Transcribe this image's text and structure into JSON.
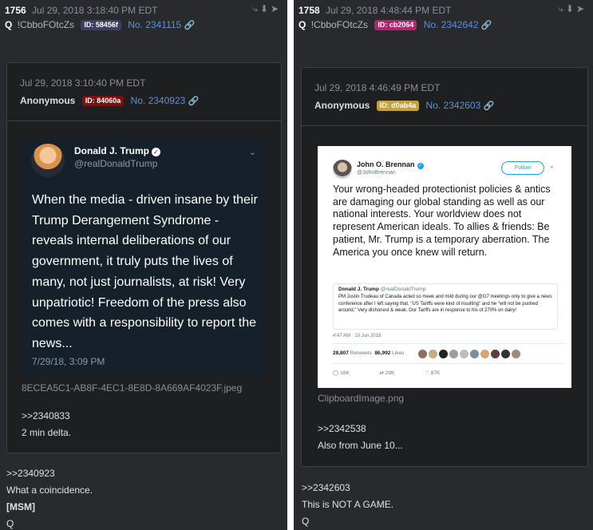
{
  "left": {
    "post_number": "1756",
    "date": "Jul 29, 2018 3:18:40 PM EDT",
    "q": "Q",
    "tripcode": "!CbboFOtcZs",
    "id_label": "ID: 58456f",
    "id_color": "#3e3f64",
    "post_link": "No. 2341115",
    "quoted": {
      "date": "Jul 29, 2018 3:10:40 PM EDT",
      "name": "Anonymous",
      "id_label": "ID: 84060a",
      "id_color": "#7a1111",
      "post_link": "No. 2340923",
      "tweet": {
        "name": "Donald J. Trump",
        "handle": "@realDonaldTrump",
        "text": "When the media - driven insane by their Trump Derangement Syndrome - reveals internal deliberations of our government, it truly puts the lives of many, not just journalists, at risk! Very unpatriotic! Freedom of the press also comes with a responsibility to report the news...",
        "timestamp": "7/29/18, 3:09 PM"
      },
      "filename": "8ECEA5C1-AB8F-4EC1-8E8D-8A669AF4023F.jpeg",
      "body": [
        ">>2340833",
        "2 min delta."
      ]
    },
    "body": [
      ">>2340923",
      "What a coincidence.",
      "[MSM]",
      "Q"
    ]
  },
  "right": {
    "post_number": "1758",
    "date": "Jul 29, 2018 4:48:44 PM EDT",
    "q": "Q",
    "tripcode": "!CbboFOtcZs",
    "id_label": "ID: cb2064",
    "id_color": "#b3246c",
    "post_link": "No. 2342642",
    "quoted": {
      "date": "Jul 29, 2018 4:46:49 PM EDT",
      "name": "Anonymous",
      "id_label": "ID: d0ab4a",
      "id_color": "#c8a03c",
      "post_link": "No. 2342603",
      "tweet": {
        "name": "John O. Brennan",
        "handle": "@JohnBrennan",
        "follow": "Follow",
        "text": "Your wrong-headed protectionist policies & antics are damaging our global standing as well as our national interests. Your worldview does not represent American ideals. To allies & friends: Be patient, Mr. Trump is a temporary aberration. The America you once knew will return.",
        "quoted_name": "Donald J. Trump",
        "quoted_handle": "@realDonaldTrump",
        "quoted_text": "PM Justin Trudeau of Canada acted so meek and mild during our @G7 meetings only to give a news conference after I left saying that, \"US Tariffs were kind of insulting\" and he \"will not be pushed around.\" Very dishonest & weak. Our Tariffs are in response to his of 270% on dairy!",
        "quoted_timestamp": "4:47 AM · 10 Jun 2018",
        "timestamp": "",
        "retweets": "28,807",
        "retweets_label": "Retweets",
        "likes": "86,992",
        "likes_label": "Likes",
        "replies": "16K",
        "rts_short": "29K",
        "likes_short": "87K"
      },
      "filename": "ClipboardImage.png",
      "body": [
        ">>2342538",
        "Also from June 10..."
      ]
    },
    "body": [
      ">>2342603",
      "This is NOT A GAME.",
      "Q"
    ]
  },
  "icons": [
    "share-icon",
    "download-icon",
    "arrow-circle-icon",
    "link-icon",
    "verified-icon",
    "chevron-down-icon"
  ]
}
